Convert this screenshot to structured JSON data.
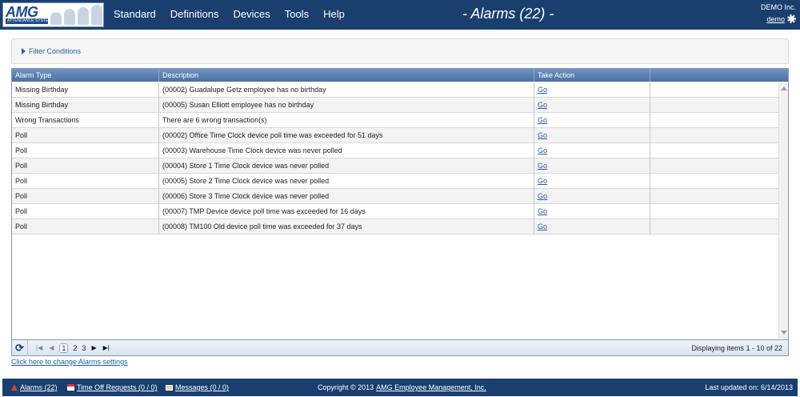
{
  "header": {
    "logo_text": "AMG",
    "logo_subtitle": "ATTENDANCE SYSTEM",
    "nav": [
      "Standard",
      "Definitions",
      "Devices",
      "Tools",
      "Help"
    ],
    "page_title": "- Alarms (22) -",
    "company": "DEMO Inc.",
    "user": "demo"
  },
  "filter": {
    "label": "Filter Conditions"
  },
  "grid": {
    "columns": [
      "Alarm Type",
      "Description",
      "Take Action"
    ],
    "rows": [
      {
        "type": "Missing Birthday",
        "description": "(00002) Guadalupe Getz employee has no birthday",
        "action": "Go"
      },
      {
        "type": "Missing Birthday",
        "description": "(00005) Susan Elliott employee has no birthday",
        "action": "Go"
      },
      {
        "type": "Wrong Transactions",
        "description": "There are 6 wrong transaction(s)",
        "action": "Go"
      },
      {
        "type": "Poll",
        "description": "(00002) Office Time Clock device poll time was exceeded for 51 days",
        "action": "Go"
      },
      {
        "type": "Poll",
        "description": "(00003) Warehouse Time Clock device was never polled",
        "action": "Go"
      },
      {
        "type": "Poll",
        "description": "(00004) Store 1 Time Clock device was never polled",
        "action": "Go"
      },
      {
        "type": "Poll",
        "description": "(00005) Store 2 Time Clock device was never polled",
        "action": "Go"
      },
      {
        "type": "Poll",
        "description": "(00006) Store 3 Time Clock device was never polled",
        "action": "Go"
      },
      {
        "type": "Poll",
        "description": "(00007) TMP Device device poll time was exceeded for 16 days",
        "action": "Go"
      },
      {
        "type": "Poll",
        "description": "(00008) TM100 Old device poll time was exceeded for 37 days",
        "action": "Go"
      }
    ]
  },
  "pager": {
    "pages": [
      "1",
      "2",
      "3"
    ],
    "current_page": "1",
    "display_text": "Displaying items 1 - 10 of 22"
  },
  "settings_link": "Click here to change Alarms settings",
  "footer": {
    "alarms": "Alarms (22)",
    "time_off": "Time Off Requests (0 / 0)",
    "messages": "Messages (0 / 0)",
    "copyright_prefix": "Copyright © 2013 ",
    "copyright_link": "AMG Employee Management, Inc.",
    "last_updated": "Last updated on: 6/14/2013"
  },
  "colors": {
    "header_bg": "#1a3f6f",
    "grid_header": "#5a7fb0",
    "link": "#1a5fb4",
    "alarm_icon": "#e03b2c"
  },
  "icons": [
    "refresh-icon",
    "first-page-icon",
    "prev-page-icon",
    "next-page-icon",
    "last-page-icon",
    "gear-icon",
    "alarm-icon",
    "calendar-icon",
    "mail-icon",
    "expand-icon"
  ]
}
